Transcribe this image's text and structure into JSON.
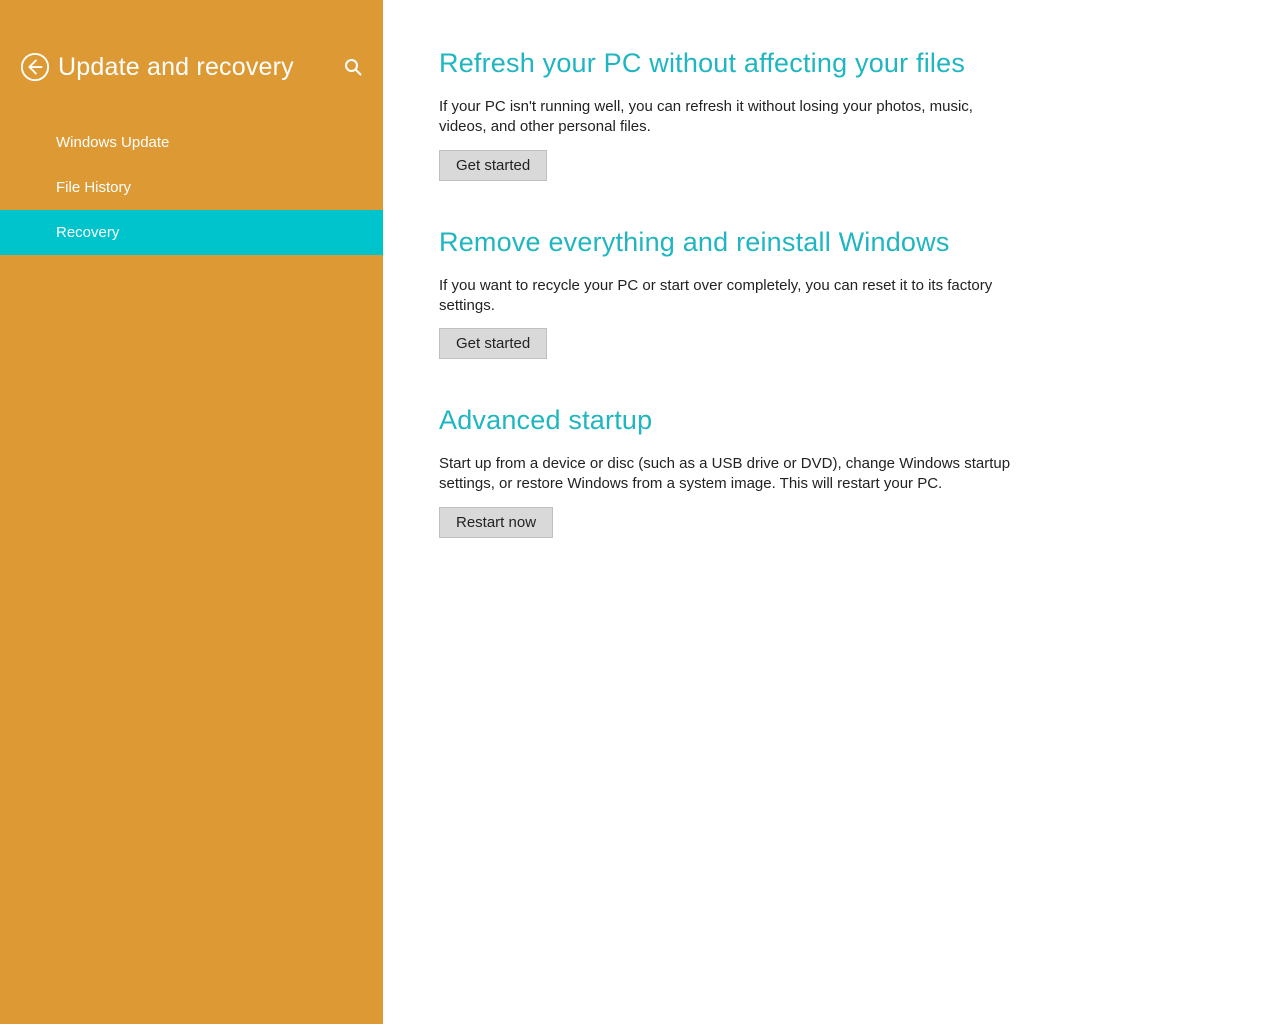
{
  "sidebar": {
    "title": "Update and recovery",
    "items": [
      {
        "label": "Windows Update",
        "selected": false
      },
      {
        "label": "File History",
        "selected": false
      },
      {
        "label": "Recovery",
        "selected": true
      }
    ]
  },
  "main": {
    "sections": [
      {
        "heading": "Refresh your PC without affecting your files",
        "description": "If your PC isn't running well, you can refresh it without losing your photos, music, videos, and other personal files.",
        "button_label": "Get started"
      },
      {
        "heading": "Remove everything and reinstall Windows",
        "description": "If you want to recycle your PC or start over completely, you can reset it to its factory settings.",
        "button_label": "Get started"
      },
      {
        "heading": "Advanced startup",
        "description": "Start up from a device or disc (such as a USB drive or DVD), change Windows startup settings, or restore Windows from a system image. This will restart your PC.",
        "button_label": "Restart now"
      }
    ]
  },
  "colors": {
    "sidebar_bg": "#dd9933",
    "selected_bg": "#00c4cc",
    "heading": "#1fb6c1"
  }
}
